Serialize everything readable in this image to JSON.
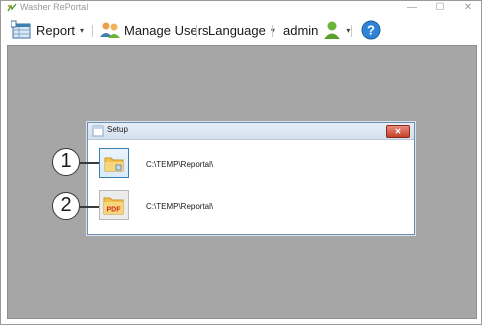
{
  "app": {
    "title": "Washer RePortal",
    "window_controls": {
      "minimize": "—",
      "maximize": "☐",
      "close": "✕"
    }
  },
  "menu": {
    "report_label": "Report",
    "manage_users_label": "Manage Users",
    "language_label": "Language",
    "user_label": "admin",
    "caret": "▾"
  },
  "dialog": {
    "title": "Setup",
    "close_glyph": "✕",
    "rows": [
      {
        "callout": "1",
        "icon": "folder-icon",
        "path": "C:\\TEMP\\Reportal\\"
      },
      {
        "callout": "2",
        "icon": "pdf-folder-icon",
        "path": "C:\\TEMP\\Reportal\\",
        "icon_text": "PDF"
      }
    ]
  },
  "colors": {
    "workspace": "#a6a6a6",
    "accent": "#3c7fb1",
    "help": "#2f84d6",
    "user": "#6cb33a"
  }
}
